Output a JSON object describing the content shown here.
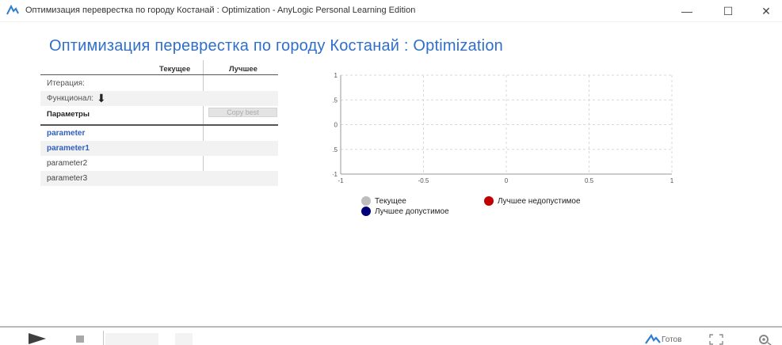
{
  "window": {
    "title": "Оптимизация перевpестка по городу Костанай : Optimization - AnyLogic Personal Learning Edition",
    "minimize": "—",
    "maximize": "☐",
    "close": "✕"
  },
  "page": {
    "heading": "Оптимизация перевpестка по городу Костанай : Optimization"
  },
  "table": {
    "col_current": "Текущее",
    "col_best": "Лучшее",
    "rows": [
      {
        "label": "Итерация:"
      },
      {
        "label": "Функционал:"
      }
    ],
    "params_header": "Параметры",
    "copy_best_label": "Copy best",
    "parameters": [
      {
        "name": "parameter",
        "active": true
      },
      {
        "name": "parameter1",
        "active": true
      },
      {
        "name": "parameter2",
        "active": false
      },
      {
        "name": "parameter3",
        "active": false
      }
    ]
  },
  "chart_data": {
    "type": "scatter",
    "series": [],
    "xlim": [
      -1,
      1
    ],
    "ylim": [
      -1,
      1
    ],
    "x_ticks": [
      "-1",
      "-0.5",
      "0",
      "0.5",
      "1"
    ],
    "y_ticks": [
      "1",
      "0.5",
      "0",
      "-0.5",
      "-1"
    ],
    "grid": true,
    "legend": [
      {
        "label": "Текущее",
        "color": "#bdbdbd"
      },
      {
        "label": "Лучшее недопустимое",
        "color": "#c00000"
      },
      {
        "label": "Лучшее допустимое",
        "color": "#00007a"
      }
    ],
    "legend_position": "bottom"
  },
  "statusbar": {
    "status_text": "Готов"
  },
  "colors": {
    "accent": "#2f6fcb",
    "param_active": "#2f5fbf"
  }
}
